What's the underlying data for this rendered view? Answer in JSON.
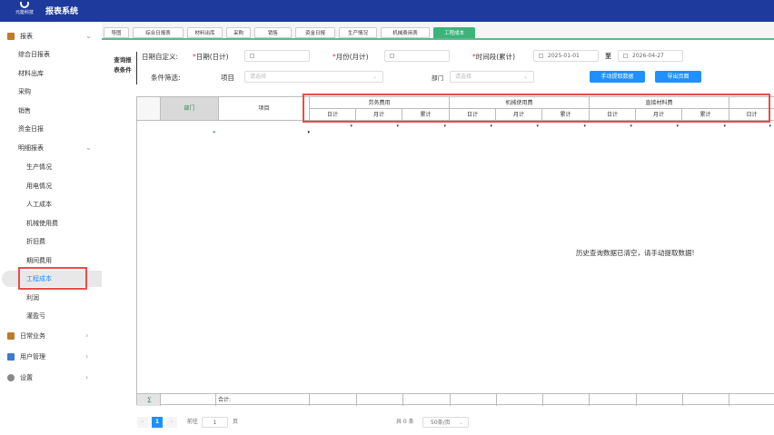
{
  "header": {
    "logo_text": "元能科技",
    "title": "报表系统"
  },
  "sidebar": {
    "groups": [
      {
        "label": "报表",
        "icon": "chart-icon",
        "expanded": true
      },
      {
        "label": "日常业务",
        "icon": "briefcase-icon"
      },
      {
        "label": "用户管理",
        "icon": "user-icon"
      },
      {
        "label": "设置",
        "icon": "gear-icon"
      }
    ],
    "items": [
      "综合日报表",
      "材料出库",
      "采购",
      "销售",
      "资金日报"
    ],
    "sub_group": "明细报表",
    "sub_items": [
      "生产情况",
      "用电情况",
      "人工成本",
      "机械使用费",
      "折旧费",
      "期间费用",
      "工程成本",
      "利润",
      "灌盈亏"
    ],
    "active": "工程成本"
  },
  "tabs": [
    "导图",
    "综合日报表",
    "材料出库",
    "采购",
    "销售",
    "资金日报",
    "生产情况",
    "机械费用表",
    "工程成本"
  ],
  "active_tab": "工程成本",
  "query": {
    "section_label": "查询报表条件",
    "date_custom_label": "日期自定义:",
    "day_label": "日期(日计)",
    "month_label": "月份(月计)",
    "period_label": "时间段(累计)",
    "start_date": "2025-01-01",
    "to_label": "至",
    "end_date": "2026-04-27",
    "filter_label": "条件筛选:",
    "project_label": "项目",
    "project_placeholder": "请选择",
    "dept_label": "部门",
    "dept_placeholder": "请选择",
    "fetch_button": "手动提取数据",
    "export_button": "导出页面"
  },
  "table": {
    "columns": [
      "部门",
      "项目"
    ],
    "groups": [
      {
        "label": "劳务费用",
        "subs": [
          "日计",
          "月计",
          "累计"
        ]
      },
      {
        "label": "机械使用费",
        "subs": [
          "日计",
          "月计",
          "累计"
        ]
      },
      {
        "label": "直接材料费",
        "subs": [
          "日计",
          "月计",
          "累计"
        ]
      },
      {
        "label": "",
        "subs": [
          "日计"
        ]
      }
    ],
    "empty_message": "历史查询数据已清空，请手动提取数据!",
    "sum_symbol": "∑",
    "total_label": "合计:"
  },
  "pagination": {
    "current": "1",
    "goto_label": "前往",
    "goto_value": "1",
    "page_unit": "页",
    "total": "共 0 条",
    "page_size": "50条/页"
  },
  "colors": {
    "header": "#1e3a9c",
    "accent": "#1e90ff",
    "tab_active": "#3cb37a",
    "highlight": "#e84c4c"
  }
}
